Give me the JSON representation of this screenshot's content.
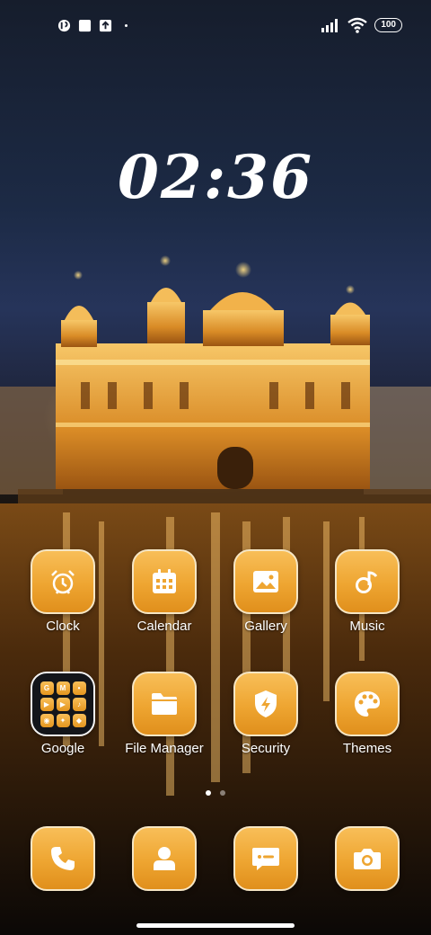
{
  "status_bar": {
    "notification_icons": [
      "app-notification-icon",
      "square-notification-icon",
      "upload-notification-icon"
    ],
    "signal_icon": "signal-bars-icon",
    "wifi_icon": "wifi-icon",
    "battery_level": "100"
  },
  "clock": {
    "time": "02:36"
  },
  "apps_row1": [
    {
      "label": "Clock",
      "icon": "alarm-clock-icon"
    },
    {
      "label": "Calendar",
      "icon": "calendar-icon"
    },
    {
      "label": "Gallery",
      "icon": "image-icon"
    },
    {
      "label": "Music",
      "icon": "music-note-icon"
    }
  ],
  "apps_row2": [
    {
      "label": "Google",
      "icon": "folder-icon",
      "folder_items": [
        "G",
        "M",
        "•",
        "▶",
        "▶",
        "♪",
        "◉",
        "✦",
        "◆"
      ]
    },
    {
      "label": "File Manager",
      "icon": "folder-icon"
    },
    {
      "label": "Security",
      "icon": "shield-bolt-icon"
    },
    {
      "label": "Themes",
      "icon": "palette-icon"
    }
  ],
  "dock": [
    {
      "icon": "phone-icon"
    },
    {
      "icon": "contacts-icon"
    },
    {
      "icon": "messages-icon"
    },
    {
      "icon": "camera-icon"
    }
  ],
  "page_indicator": {
    "pages": 2,
    "current": 1
  },
  "colors": {
    "icon_fill": "#eea531",
    "icon_border": "#f6e6c4",
    "text": "#ffffff"
  }
}
